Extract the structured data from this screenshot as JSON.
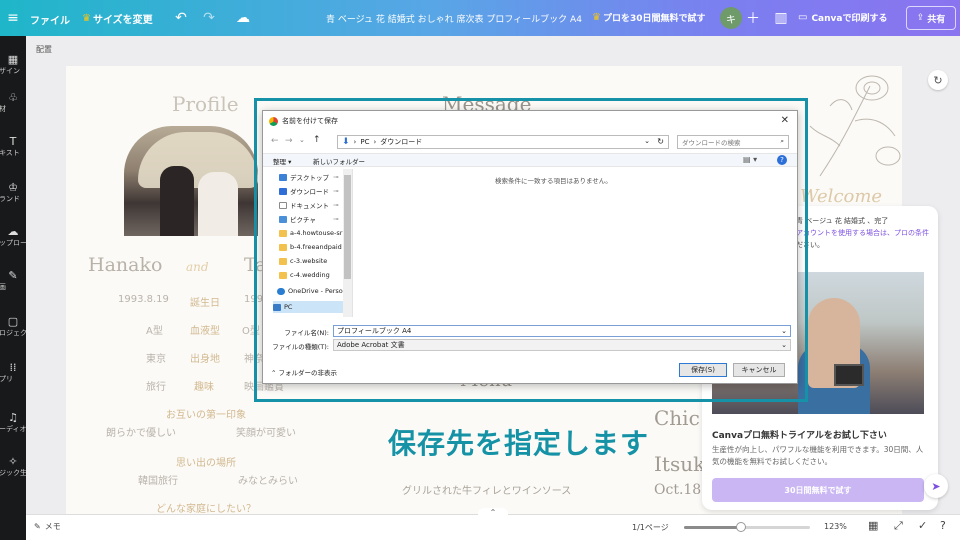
{
  "topbar": {
    "file_label": "ファイル",
    "resize_label": "サイズを変更",
    "doc_title": "青 ベージュ 花 結婚式 おしゃれ 席次表 プロフィールブック A4",
    "pro_trial_label": "プロを30日間無料で試す",
    "avatar_initial": "キ",
    "print_label": "Canvaで印刷する",
    "share_label": "共有"
  },
  "rail": {
    "items": [
      {
        "label": "デザイン",
        "icon": "design-icon"
      },
      {
        "label": "素材",
        "icon": "elements-icon"
      },
      {
        "label": "テキスト",
        "icon": "text-icon"
      },
      {
        "label": "ブランド",
        "icon": "brand-icon"
      },
      {
        "label": "アップロード",
        "icon": "upload-icon"
      },
      {
        "label": "描画",
        "icon": "draw-icon"
      },
      {
        "label": "プロジェクト",
        "icon": "projects-icon"
      },
      {
        "label": "アプリ",
        "icon": "apps-icon"
      },
      {
        "label": "オーディオ",
        "icon": "audio-icon"
      },
      {
        "label": "マジック生成",
        "icon": "magic-icon"
      }
    ]
  },
  "canvas": {
    "breadcrumb": "配置",
    "profile_heading": "Profile",
    "message_heading": "Message",
    "welcome_heading": "Welcome",
    "name_left": "Hanako",
    "name_and": "and",
    "name_right": "Ta",
    "rows": [
      {
        "left": "1993.8.19",
        "center": "誕生日",
        "right": "199"
      },
      {
        "left": "A型",
        "center": "血液型",
        "right": "O型"
      },
      {
        "left": "東京",
        "center": "出身地",
        "right": "神奈"
      },
      {
        "left": "旅行",
        "center": "趣味",
        "right": "映画鑑賞"
      }
    ],
    "first_impression_title": "お互いの第一印象",
    "first_impression_left": "朗らかで優しい",
    "first_impression_right": "笑顔が可愛い",
    "memories_title": "思い出の場所",
    "memories_left": "韓国旅行",
    "memories_right": "みなとみらい",
    "family_title": "どんな家庭にしたい？",
    "menu_heading": "Menu",
    "menu_item": "グリルされた牛フィレとワインソース",
    "right_name_a": "Chic",
    "right_name_b": "Itsuk",
    "right_date": "Oct.18"
  },
  "promo": {
    "top_text_1": "青 ベージュ 花 結婚式 、完了",
    "top_text_2": "ださい。",
    "top_link": "アカウントを使用する場合は、プロの条件",
    "title": "Canvaプロ無料トライアルをお試し下さい",
    "body": "生産性が向上し、パワフルな機能を利用できます。30日間、人気の機能を無料でお試しください。",
    "cta": "30日間無料で試す"
  },
  "bottombar": {
    "notes_label": "メモ",
    "page_indicator": "1/1ページ",
    "zoom_label": "123%",
    "zoom_fraction": 0.45
  },
  "dialog": {
    "title": "名前を付けて保存",
    "address_parts": [
      "PC",
      "ダウンロード"
    ],
    "search_placeholder": "ダウンロードの検索",
    "organize_label": "整理",
    "new_folder_label": "新しいフォルダー",
    "tree_items": [
      {
        "label": "デスクトップ",
        "pinned": true,
        "color": "#3b82d6"
      },
      {
        "label": "ダウンロード",
        "pinned": true,
        "color": "#2e6ed6"
      },
      {
        "label": "ドキュメント",
        "pinned": true,
        "color": "#8a8a8a"
      },
      {
        "label": "ピクチャ",
        "pinned": true,
        "color": "#4a90d9"
      },
      {
        "label": "a-4.howtouse-sr",
        "pinned": false,
        "color": "#f2c14e"
      },
      {
        "label": "b-4.freeandpaid",
        "pinned": false,
        "color": "#f2c14e"
      },
      {
        "label": "c-3.website",
        "pinned": false,
        "color": "#f2c14e"
      },
      {
        "label": "c-4.wedding",
        "pinned": false,
        "color": "#f2c14e"
      },
      {
        "label": "OneDrive - Person",
        "pinned": false,
        "color": "#2a7dd1"
      },
      {
        "label": "PC",
        "pinned": false,
        "color": "#3a7bc8"
      }
    ],
    "empty_message": "検索条件に一致する項目はありません。",
    "filename_label": "ファイル名(N):",
    "filename_value": "プロフィールブック A4",
    "filetype_label": "ファイルの種類(T):",
    "filetype_value": "Adobe Acrobat 文書",
    "hide_folders_label": "フォルダーの非表示",
    "save_label": "保存(S)",
    "cancel_label": "キャンセル"
  },
  "caption": "保存先を指定します"
}
